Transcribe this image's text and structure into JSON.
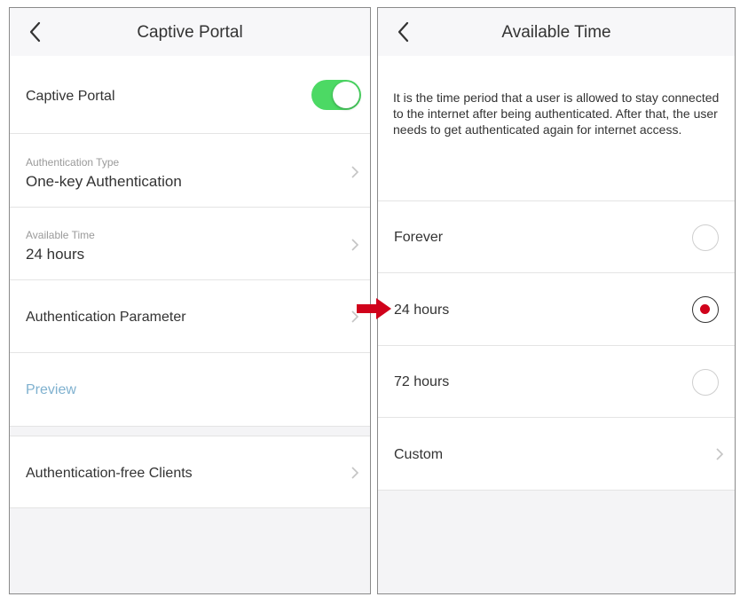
{
  "left": {
    "title": "Captive Portal",
    "captive_portal": {
      "label": "Captive Portal",
      "enabled": true
    },
    "auth_type": {
      "sub": "Authentication Type",
      "value": "One-key Authentication"
    },
    "available_time": {
      "sub": "Available Time",
      "value": "24 hours"
    },
    "auth_param": {
      "label": "Authentication Parameter"
    },
    "preview": {
      "label": "Preview"
    },
    "auth_free": {
      "label": "Authentication-free Clients"
    }
  },
  "right": {
    "title": "Available Time",
    "description": "It is the time period that a user is allowed to stay connected to the internet after being authenticated. After that, the user needs to get authenticated again for internet access.",
    "options": [
      {
        "label": "Forever",
        "selected": false
      },
      {
        "label": "24 hours",
        "selected": true
      },
      {
        "label": "72 hours",
        "selected": false
      }
    ],
    "custom": {
      "label": "Custom"
    }
  },
  "colors": {
    "toggle_on": "#4cd964",
    "radio_selected": "#d0021b",
    "arrow": "#d0021b",
    "preview_link": "#7fb1cf"
  },
  "icons": {
    "back": "chevron-left-icon",
    "disclosure": "chevron-right-icon",
    "pointer": "right-arrow-icon"
  }
}
